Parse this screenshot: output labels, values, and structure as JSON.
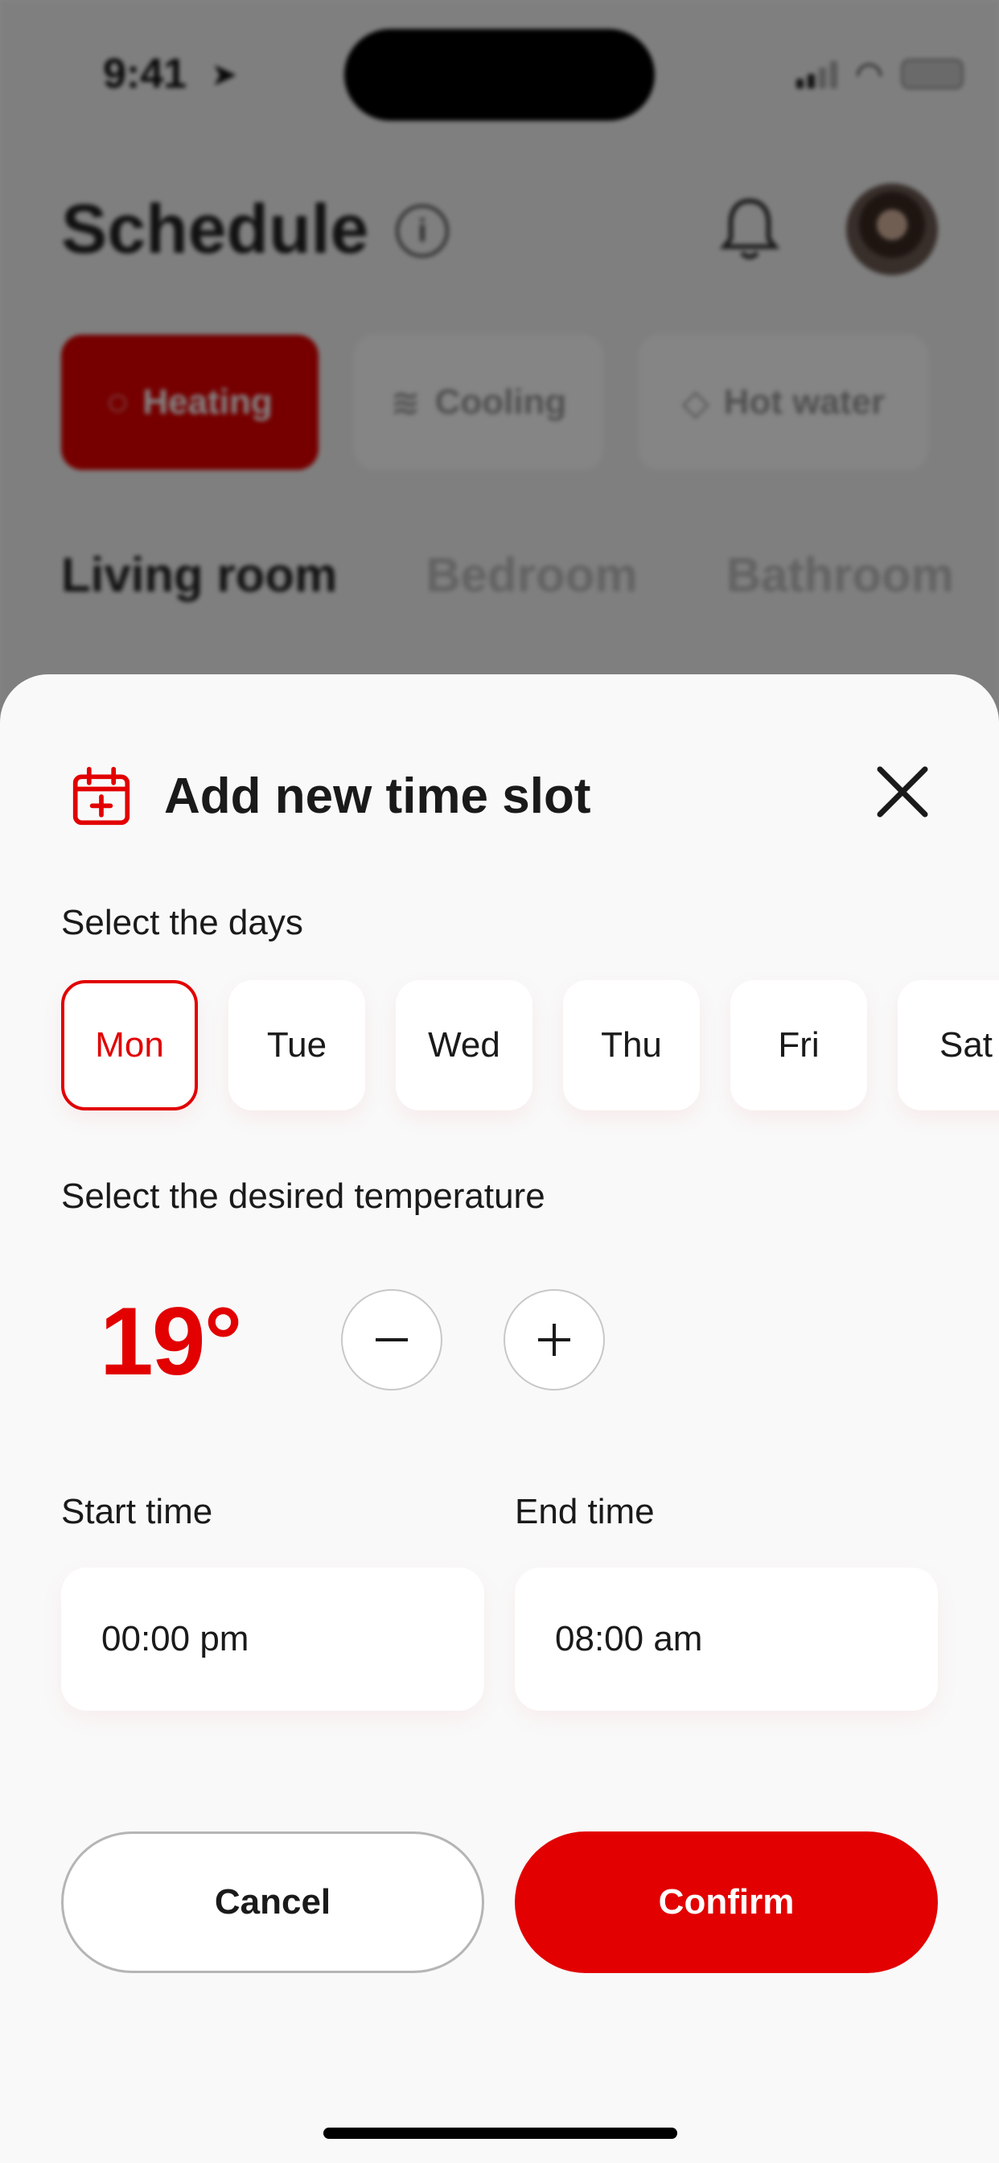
{
  "status_bar": {
    "time": "9:41",
    "location_icon": "location-arrow-icon",
    "signal_icon": "cellular-signal-icon",
    "wifi_icon": "wifi-icon",
    "battery_icon": "battery-icon"
  },
  "background": {
    "title": "Schedule",
    "info_icon": "info-icon",
    "bell_icon": "bell-icon",
    "tabs": [
      {
        "label": "Heating",
        "icon": "heating-icon",
        "active": true
      },
      {
        "label": "Cooling",
        "icon": "cooling-icon",
        "active": false
      },
      {
        "label": "Hot water",
        "icon": "water-drop-icon",
        "active": false
      }
    ],
    "rooms": [
      {
        "label": "Living room",
        "active": true
      },
      {
        "label": "Bedroom",
        "active": false
      },
      {
        "label": "Bathroom",
        "active": false
      }
    ]
  },
  "sheet": {
    "title": "Add new time slot",
    "calendar_icon": "calendar-add-icon",
    "close_icon": "close-icon",
    "days_label": "Select the days",
    "days": [
      {
        "label": "Mon",
        "selected": true
      },
      {
        "label": "Tue",
        "selected": false
      },
      {
        "label": "Wed",
        "selected": false
      },
      {
        "label": "Thu",
        "selected": false
      },
      {
        "label": "Fri",
        "selected": false
      },
      {
        "label": "Sat",
        "selected": false
      }
    ],
    "temperature_label": "Select the desired temperature",
    "temperature": "19°",
    "minus_icon": "minus-icon",
    "plus_icon": "plus-icon",
    "start_label": "Start time",
    "start_value": "00:00 pm",
    "end_label": "End time",
    "end_value": "08:00 am",
    "cancel_label": "Cancel",
    "confirm_label": "Confirm"
  },
  "colors": {
    "accent": "#e20000",
    "sheet_background": "#f9f9f9",
    "field_background": "#ffffff",
    "text": "#1a1a1a"
  }
}
